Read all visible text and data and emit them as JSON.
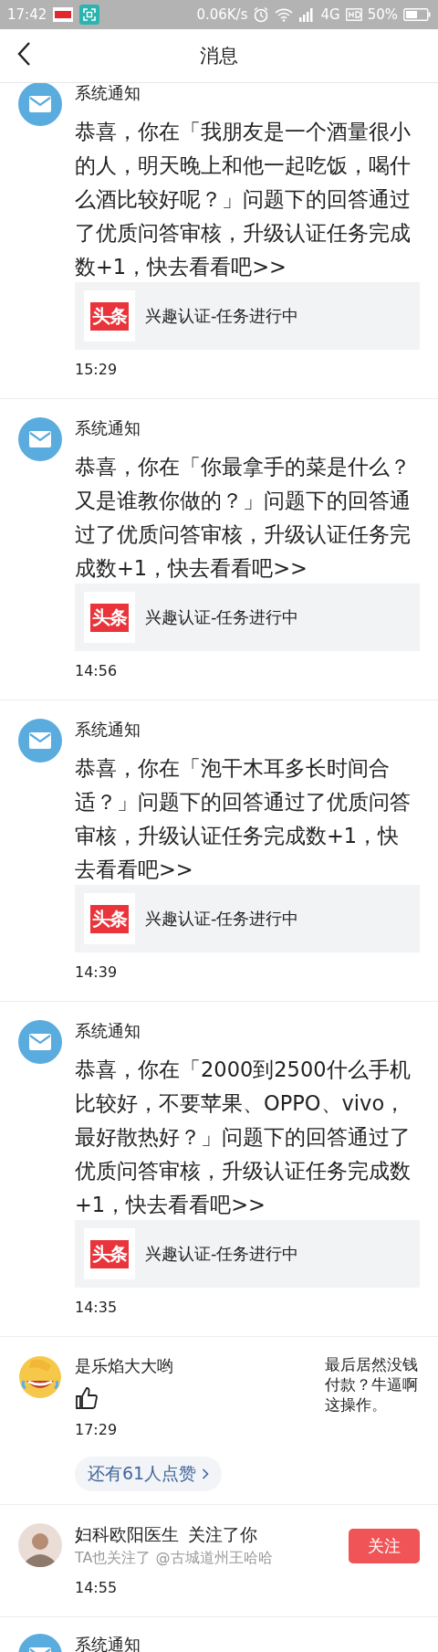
{
  "status_bar": {
    "time": "17:42",
    "speed": "0.06K/s",
    "network": "4G",
    "battery": "50%"
  },
  "header": {
    "title": "消息"
  },
  "messages": [
    {
      "kind": "system",
      "title": "系统通知",
      "body": "恭喜，你在「我朋友是一个酒量很小的人，明天晚上和他一起吃饭，喝什么酒比较好呢？」问题下的回答通过了优质问答审核，升级认证任务完成数+1，快去看看吧>>",
      "card": {
        "logo": "头条",
        "text": "兴趣认证-任务进行中"
      },
      "time": "15:29"
    },
    {
      "kind": "system",
      "title": "系统通知",
      "body": "恭喜，你在「你最拿手的菜是什么？又是谁教你做的？」问题下的回答通过了优质问答审核，升级认证任务完成数+1，快去看看吧>>",
      "card": {
        "logo": "头条",
        "text": "兴趣认证-任务进行中"
      },
      "time": "14:56"
    },
    {
      "kind": "system",
      "title": "系统通知",
      "body": "恭喜，你在「泡干木耳多长时间合适？」问题下的回答通过了优质问答审核，升级认证任务完成数+1，快去看看吧>>",
      "card": {
        "logo": "头条",
        "text": "兴趣认证-任务进行中"
      },
      "time": "14:39"
    },
    {
      "kind": "system",
      "title": "系统通知",
      "body": "恭喜，你在「2000到2500什么手机比较好，不要苹果、OPPO、vivo，最好散热好？」问题下的回答通过了优质问答审核，升级认证任务完成数+1，快去看看吧>>",
      "card": {
        "logo": "头条",
        "text": "兴趣认证-任务进行中"
      },
      "time": "14:35"
    },
    {
      "kind": "like",
      "name": "是乐焰大大哟",
      "comment": "最后居然没钱付款？牛逼啊这操作。",
      "time": "17:29",
      "more": "还有61人点赞"
    },
    {
      "kind": "follow",
      "name": "妇科欧阳医生",
      "action": "关注了你",
      "sub": "TA也关注了 @古城道州王哈哈",
      "time": "14:55",
      "button": "关注"
    },
    {
      "kind": "system",
      "title": "系统通知"
    }
  ]
}
